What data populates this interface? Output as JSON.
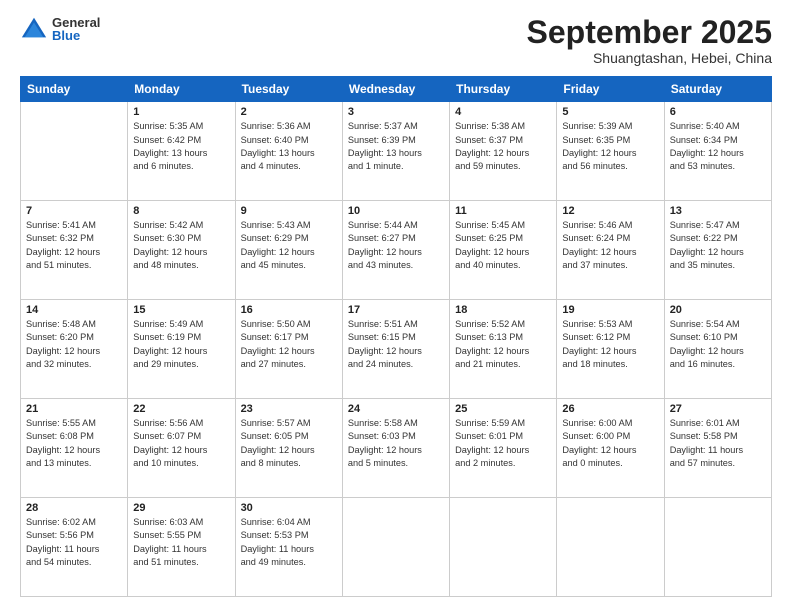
{
  "logo": {
    "general": "General",
    "blue": "Blue"
  },
  "header": {
    "month": "September 2025",
    "location": "Shuangtashan, Hebei, China"
  },
  "weekdays": [
    "Sunday",
    "Monday",
    "Tuesday",
    "Wednesday",
    "Thursday",
    "Friday",
    "Saturday"
  ],
  "weeks": [
    [
      {
        "day": "",
        "info": ""
      },
      {
        "day": "1",
        "info": "Sunrise: 5:35 AM\nSunset: 6:42 PM\nDaylight: 13 hours\nand 6 minutes."
      },
      {
        "day": "2",
        "info": "Sunrise: 5:36 AM\nSunset: 6:40 PM\nDaylight: 13 hours\nand 4 minutes."
      },
      {
        "day": "3",
        "info": "Sunrise: 5:37 AM\nSunset: 6:39 PM\nDaylight: 13 hours\nand 1 minute."
      },
      {
        "day": "4",
        "info": "Sunrise: 5:38 AM\nSunset: 6:37 PM\nDaylight: 12 hours\nand 59 minutes."
      },
      {
        "day": "5",
        "info": "Sunrise: 5:39 AM\nSunset: 6:35 PM\nDaylight: 12 hours\nand 56 minutes."
      },
      {
        "day": "6",
        "info": "Sunrise: 5:40 AM\nSunset: 6:34 PM\nDaylight: 12 hours\nand 53 minutes."
      }
    ],
    [
      {
        "day": "7",
        "info": "Sunrise: 5:41 AM\nSunset: 6:32 PM\nDaylight: 12 hours\nand 51 minutes."
      },
      {
        "day": "8",
        "info": "Sunrise: 5:42 AM\nSunset: 6:30 PM\nDaylight: 12 hours\nand 48 minutes."
      },
      {
        "day": "9",
        "info": "Sunrise: 5:43 AM\nSunset: 6:29 PM\nDaylight: 12 hours\nand 45 minutes."
      },
      {
        "day": "10",
        "info": "Sunrise: 5:44 AM\nSunset: 6:27 PM\nDaylight: 12 hours\nand 43 minutes."
      },
      {
        "day": "11",
        "info": "Sunrise: 5:45 AM\nSunset: 6:25 PM\nDaylight: 12 hours\nand 40 minutes."
      },
      {
        "day": "12",
        "info": "Sunrise: 5:46 AM\nSunset: 6:24 PM\nDaylight: 12 hours\nand 37 minutes."
      },
      {
        "day": "13",
        "info": "Sunrise: 5:47 AM\nSunset: 6:22 PM\nDaylight: 12 hours\nand 35 minutes."
      }
    ],
    [
      {
        "day": "14",
        "info": "Sunrise: 5:48 AM\nSunset: 6:20 PM\nDaylight: 12 hours\nand 32 minutes."
      },
      {
        "day": "15",
        "info": "Sunrise: 5:49 AM\nSunset: 6:19 PM\nDaylight: 12 hours\nand 29 minutes."
      },
      {
        "day": "16",
        "info": "Sunrise: 5:50 AM\nSunset: 6:17 PM\nDaylight: 12 hours\nand 27 minutes."
      },
      {
        "day": "17",
        "info": "Sunrise: 5:51 AM\nSunset: 6:15 PM\nDaylight: 12 hours\nand 24 minutes."
      },
      {
        "day": "18",
        "info": "Sunrise: 5:52 AM\nSunset: 6:13 PM\nDaylight: 12 hours\nand 21 minutes."
      },
      {
        "day": "19",
        "info": "Sunrise: 5:53 AM\nSunset: 6:12 PM\nDaylight: 12 hours\nand 18 minutes."
      },
      {
        "day": "20",
        "info": "Sunrise: 5:54 AM\nSunset: 6:10 PM\nDaylight: 12 hours\nand 16 minutes."
      }
    ],
    [
      {
        "day": "21",
        "info": "Sunrise: 5:55 AM\nSunset: 6:08 PM\nDaylight: 12 hours\nand 13 minutes."
      },
      {
        "day": "22",
        "info": "Sunrise: 5:56 AM\nSunset: 6:07 PM\nDaylight: 12 hours\nand 10 minutes."
      },
      {
        "day": "23",
        "info": "Sunrise: 5:57 AM\nSunset: 6:05 PM\nDaylight: 12 hours\nand 8 minutes."
      },
      {
        "day": "24",
        "info": "Sunrise: 5:58 AM\nSunset: 6:03 PM\nDaylight: 12 hours\nand 5 minutes."
      },
      {
        "day": "25",
        "info": "Sunrise: 5:59 AM\nSunset: 6:01 PM\nDaylight: 12 hours\nand 2 minutes."
      },
      {
        "day": "26",
        "info": "Sunrise: 6:00 AM\nSunset: 6:00 PM\nDaylight: 12 hours\nand 0 minutes."
      },
      {
        "day": "27",
        "info": "Sunrise: 6:01 AM\nSunset: 5:58 PM\nDaylight: 11 hours\nand 57 minutes."
      }
    ],
    [
      {
        "day": "28",
        "info": "Sunrise: 6:02 AM\nSunset: 5:56 PM\nDaylight: 11 hours\nand 54 minutes."
      },
      {
        "day": "29",
        "info": "Sunrise: 6:03 AM\nSunset: 5:55 PM\nDaylight: 11 hours\nand 51 minutes."
      },
      {
        "day": "30",
        "info": "Sunrise: 6:04 AM\nSunset: 5:53 PM\nDaylight: 11 hours\nand 49 minutes."
      },
      {
        "day": "",
        "info": ""
      },
      {
        "day": "",
        "info": ""
      },
      {
        "day": "",
        "info": ""
      },
      {
        "day": "",
        "info": ""
      }
    ]
  ]
}
